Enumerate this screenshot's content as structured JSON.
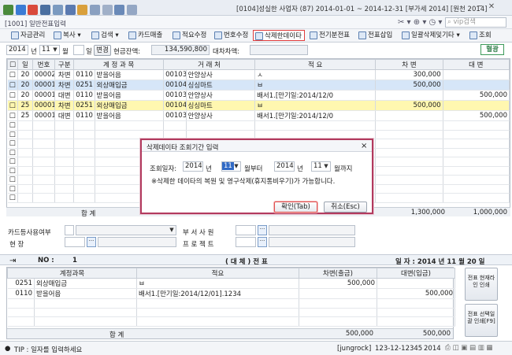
{
  "window": {
    "company_info": "[0104]성실한 사업자 (87) 2014-01-01 ~ 2014-12-31 [부가세 2014] [원천 2014]",
    "search_placeholder": "vip검색",
    "menu_code": "[1001] 일반전표입력"
  },
  "toolbar": {
    "items": [
      "자금관리",
      "복사",
      "검색",
      "카드매출",
      "적요수정",
      "번호수정",
      "삭제한데이타",
      "전기분전표",
      "전표삽입",
      "일괄삭제및기타",
      "조회"
    ]
  },
  "filter": {
    "year": "2014",
    "year_unit": "년",
    "month": "11",
    "month_unit": "월",
    "day_unit": "일",
    "change_label": "변경",
    "cash_balance_label": "현금잔액:",
    "cash_balance": "134,590,800",
    "diff_label": "대차차액:",
    "mode_badge": "혈광"
  },
  "grid": {
    "headers": [
      "일",
      "번호",
      "구분",
      "계 정 과 목",
      "거 래 처",
      "적 요",
      "차 변",
      "대 변"
    ],
    "rows": [
      {
        "day": "20",
        "no": "00002",
        "type": "차변",
        "acct_code": "0110",
        "acct": "받을어음",
        "cust_code": "00103",
        "cust": "안양상사",
        "memo": "ㅅ",
        "debit": "300,000",
        "credit": ""
      },
      {
        "day": "20",
        "no": "00001",
        "type": "차변",
        "acct_code": "0251",
        "acct": "외상매입금",
        "cust_code": "00104",
        "cust": "싱싱마트",
        "memo": "ㅂ",
        "debit": "500,000",
        "credit": ""
      },
      {
        "day": "20",
        "no": "00001",
        "type": "대변",
        "acct_code": "0110",
        "acct": "받을어음",
        "cust_code": "00103",
        "cust": "안양상사",
        "memo": "배서1.[만기일:2014/12/0",
        "debit": "",
        "credit": "500,000"
      },
      {
        "day": "25",
        "no": "00001",
        "type": "차변",
        "acct_code": "0251",
        "acct": "외상매입금",
        "cust_code": "00104",
        "cust": "싱싱마트",
        "memo": "ㅂ",
        "debit": "500,000",
        "credit": ""
      },
      {
        "day": "25",
        "no": "00001",
        "type": "대변",
        "acct_code": "0110",
        "acct": "받을어음",
        "cust_code": "00103",
        "cust": "안양상사",
        "memo": "배서1.[만기일:2014/12/0",
        "debit": "",
        "credit": "500,000"
      }
    ],
    "total_label": "합          계",
    "total_debit": "1,300,000",
    "total_credit": "1,000,000"
  },
  "fields": {
    "card_label": "카드등사용여부",
    "dept_label": "부 서 사 원",
    "site_label": "현          장",
    "project_label": "프 로 젝 트"
  },
  "ticket": {
    "no_label": "NO :",
    "no_value": "1",
    "type": "( 대 체 )  전  표",
    "date_label": "일 자 : 2014 년 11 월 20 일"
  },
  "slip": {
    "headers": [
      "계정과목",
      "적요",
      "차변(출금)",
      "대변(입금)"
    ],
    "rows": [
      {
        "code": "0251",
        "acct": "외상매입금",
        "memo": "ㅂ",
        "debit": "500,000",
        "credit": ""
      },
      {
        "code": "0110",
        "acct": "받을어음",
        "memo": "배서1.[만기일:2014/12/01].1234",
        "debit": "",
        "credit": "500,000"
      }
    ],
    "total_label": "합          계",
    "total_debit": "500,000",
    "total_credit": "500,000",
    "side_btn1": "전표 현재라인 인쇄",
    "side_btn2": "전표 선택일괄 인쇄[F9]"
  },
  "status": {
    "tip": "TIP : 일자를 입력하세요",
    "user": "[jungrock]",
    "code": "123-12-12345",
    "year": "2014"
  },
  "modal": {
    "title": "삭제데이타 조회기간 입력",
    "period_label": "조회일자:",
    "from_year": "2014",
    "year_unit": "년",
    "from_month": "11",
    "from_suffix": "월부터",
    "to_year": "2014",
    "to_month": "11",
    "to_suffix": "월까지",
    "note": "※삭제한 데이타의 복원 및 영구삭제(휴지통비우기)가 가능합니다.",
    "ok_label": "확인(Tab)",
    "cancel_label": "취소(Esc)"
  }
}
